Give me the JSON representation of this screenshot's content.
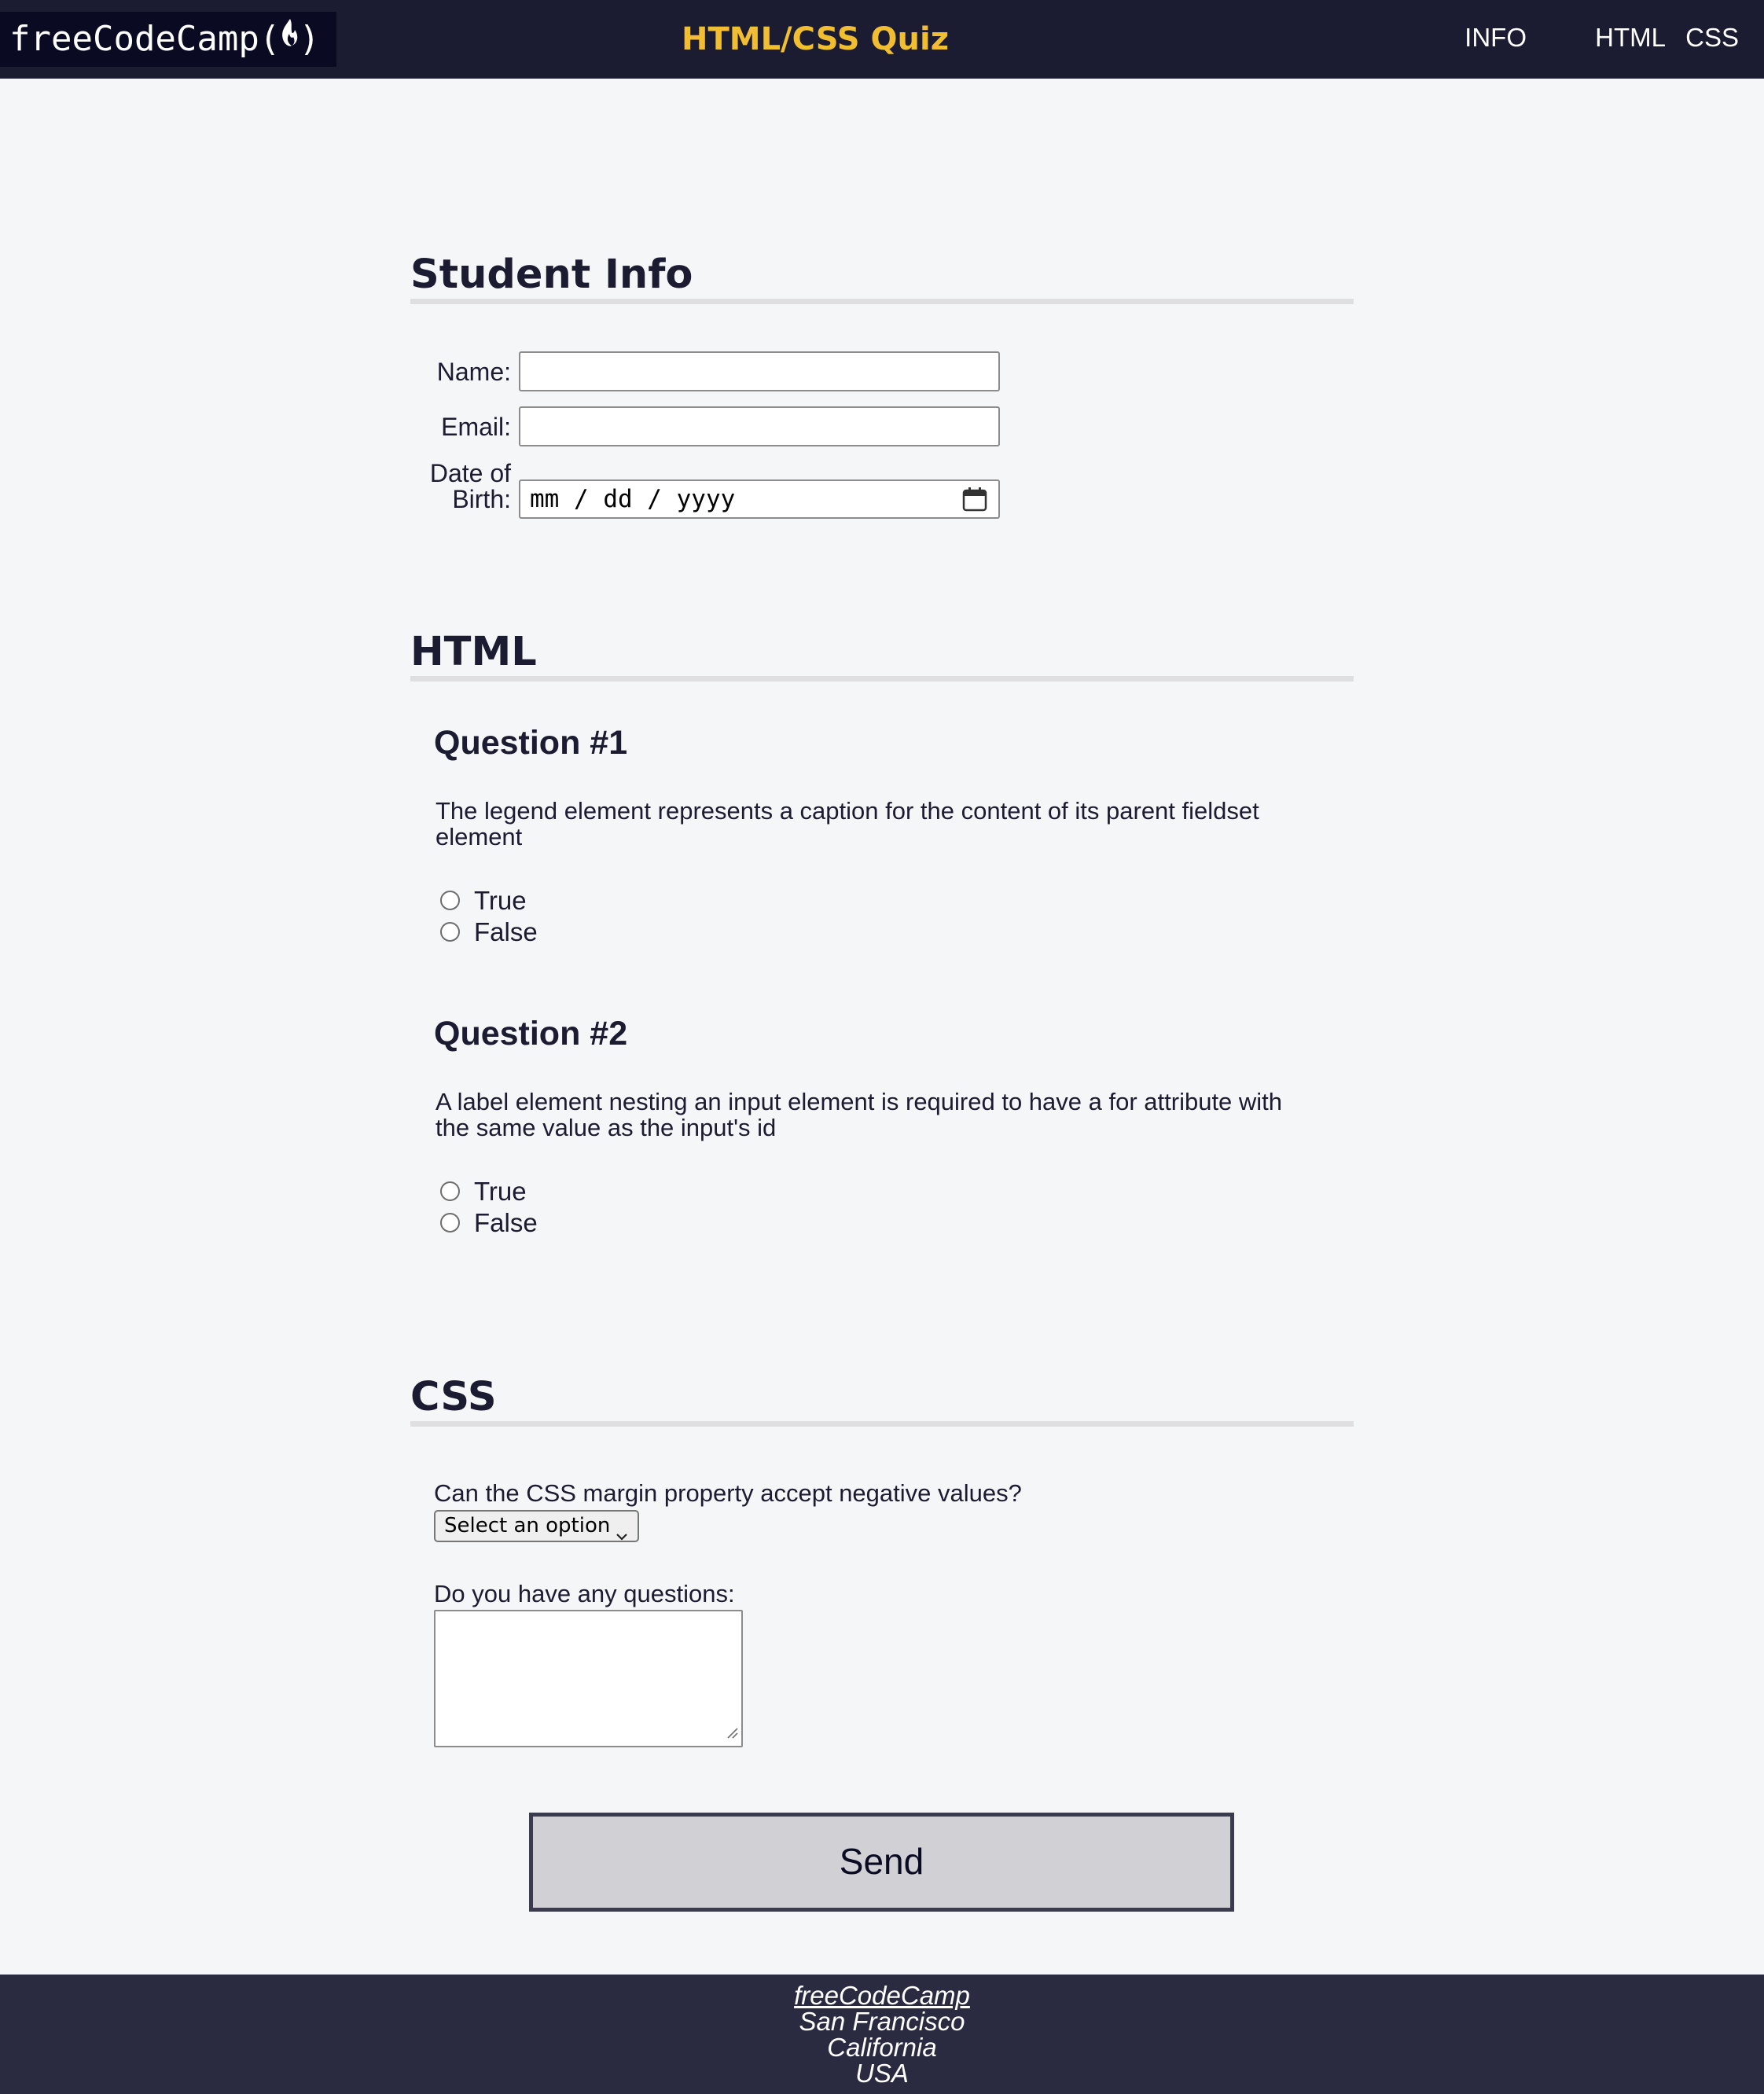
{
  "header": {
    "logo_text": "freeCodeCamp(",
    "logo_close": ")",
    "title": "HTML/CSS Quiz",
    "nav": [
      "INFO",
      "HTML",
      "CSS"
    ]
  },
  "student_info": {
    "heading": "Student Info",
    "name_label": "Name:",
    "name_value": "",
    "email_label": "Email:",
    "email_value": "",
    "dob_label_line1": "Date of",
    "dob_label_line2": "Birth:",
    "dob_placeholder": "mm / dd / yyyy"
  },
  "html_section": {
    "heading": "HTML",
    "questions": [
      {
        "title": "Question #1",
        "text_line1": "The legend element represents a caption for the content of its parent fieldset",
        "text_line2": "element",
        "options": [
          "True",
          "False"
        ]
      },
      {
        "title": "Question #2",
        "text_line1": "A label element nesting an input element is required to have a for attribute with",
        "text_line2": "the same value as the input's id",
        "options": [
          "True",
          "False"
        ]
      }
    ]
  },
  "css_section": {
    "heading": "CSS",
    "select_question": "Can the CSS margin property accept negative values?",
    "select_value": "Select an option",
    "textarea_label": "Do you have any questions:",
    "textarea_value": ""
  },
  "send_label": "Send",
  "footer": {
    "link": "freeCodeCamp",
    "lines": [
      "San Francisco",
      "California",
      "USA"
    ]
  },
  "colors": {
    "header_bg": "#1b1b32",
    "title_accent": "#f1be32",
    "page_bg": "#f5f6f7",
    "footer_bg": "#2a2a40",
    "button_bg": "#d0d0d5"
  },
  "icons": [
    "flame-icon",
    "calendar-icon",
    "chevron-down-icon",
    "resize-grip-icon"
  ]
}
